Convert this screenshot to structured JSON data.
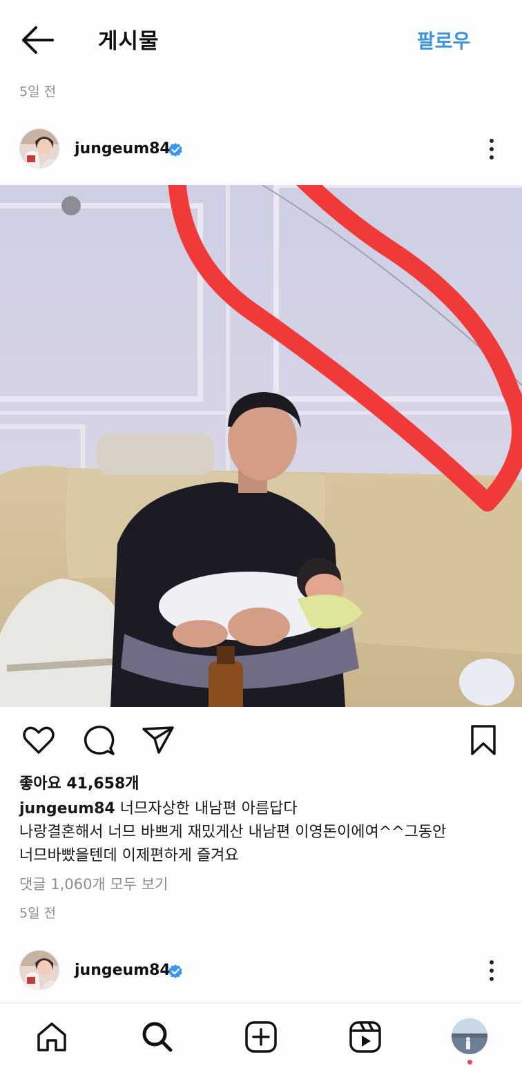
{
  "header": {
    "title": "게시물",
    "follow_label": "팔로우"
  },
  "post": {
    "time_top": "5일 전",
    "username": "jungeum84",
    "likes_text": "좋아요 41,658개",
    "caption_username": "jungeum84",
    "caption_line1": "너므자상한 내남편 아름답다",
    "caption_line2": "나랑결혼해서 너므 바쁘게 재밌게산 내남편 이영돈이에여^^그동안",
    "caption_line3": "너므바빴을텐데 이제편하게 즐겨요",
    "comments_text": "댓글 1,060개 모두 보기",
    "time_bottom": "5일 전"
  },
  "next_post": {
    "username": "jungeum84"
  },
  "icons": {
    "back": "arrow-left-icon",
    "verified": "verified-badge-icon",
    "more": "more-vertical-icon",
    "like": "heart-icon",
    "comment": "comment-icon",
    "share": "send-icon",
    "save": "bookmark-icon",
    "home": "home-icon",
    "search": "search-icon",
    "create": "plus-square-icon",
    "reels": "reels-icon"
  },
  "colors": {
    "accent": "#3b95de",
    "verified": "#3897f0",
    "annotation": "#f03a3a",
    "notification": "#ed4956"
  }
}
